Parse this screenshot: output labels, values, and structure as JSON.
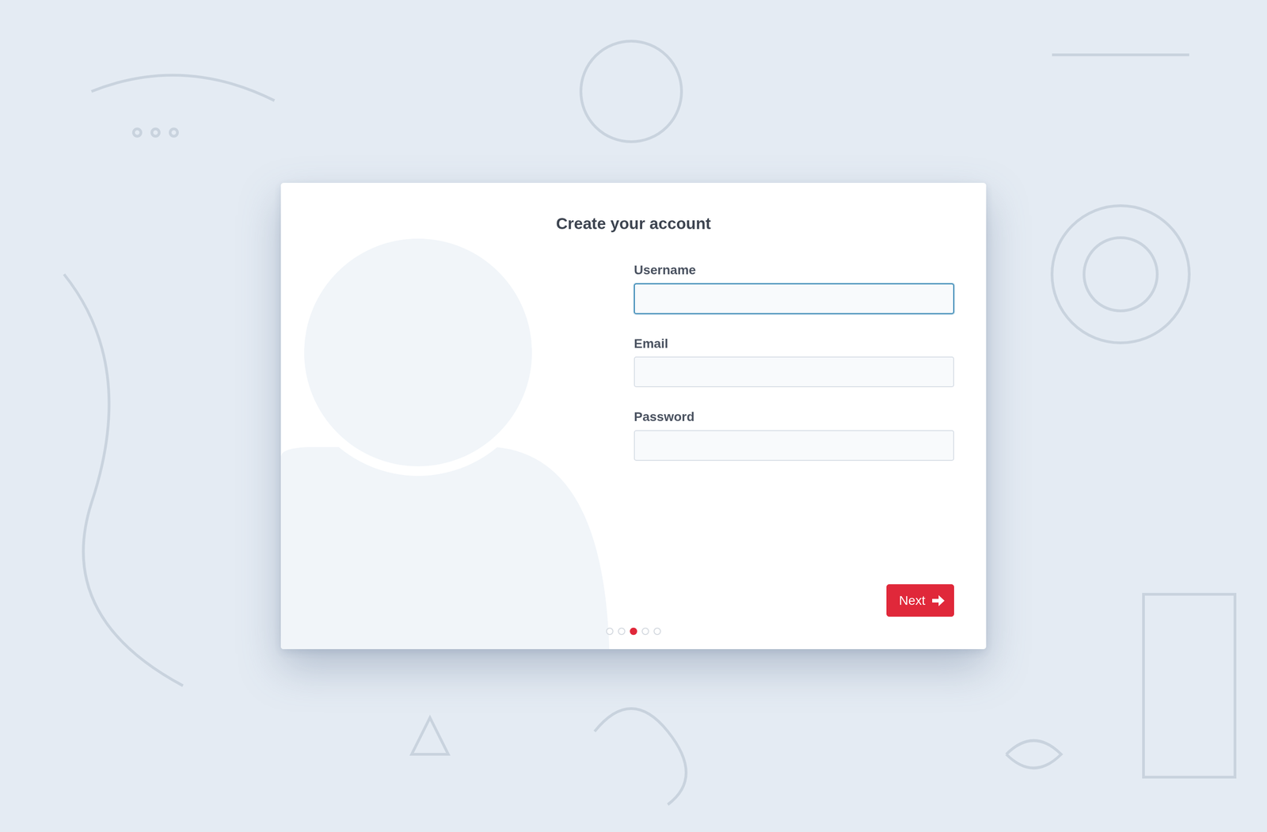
{
  "title": "Create your account",
  "fields": [
    {
      "label": "Username",
      "value": "",
      "focused": true
    },
    {
      "label": "Email",
      "value": "",
      "focused": false
    },
    {
      "label": "Password",
      "value": "",
      "focused": false
    }
  ],
  "next_button": {
    "label": "Next"
  },
  "steps": [
    {
      "selected": false
    },
    {
      "selected": false
    },
    {
      "selected": true
    },
    {
      "selected": false
    },
    {
      "selected": false
    }
  ]
}
